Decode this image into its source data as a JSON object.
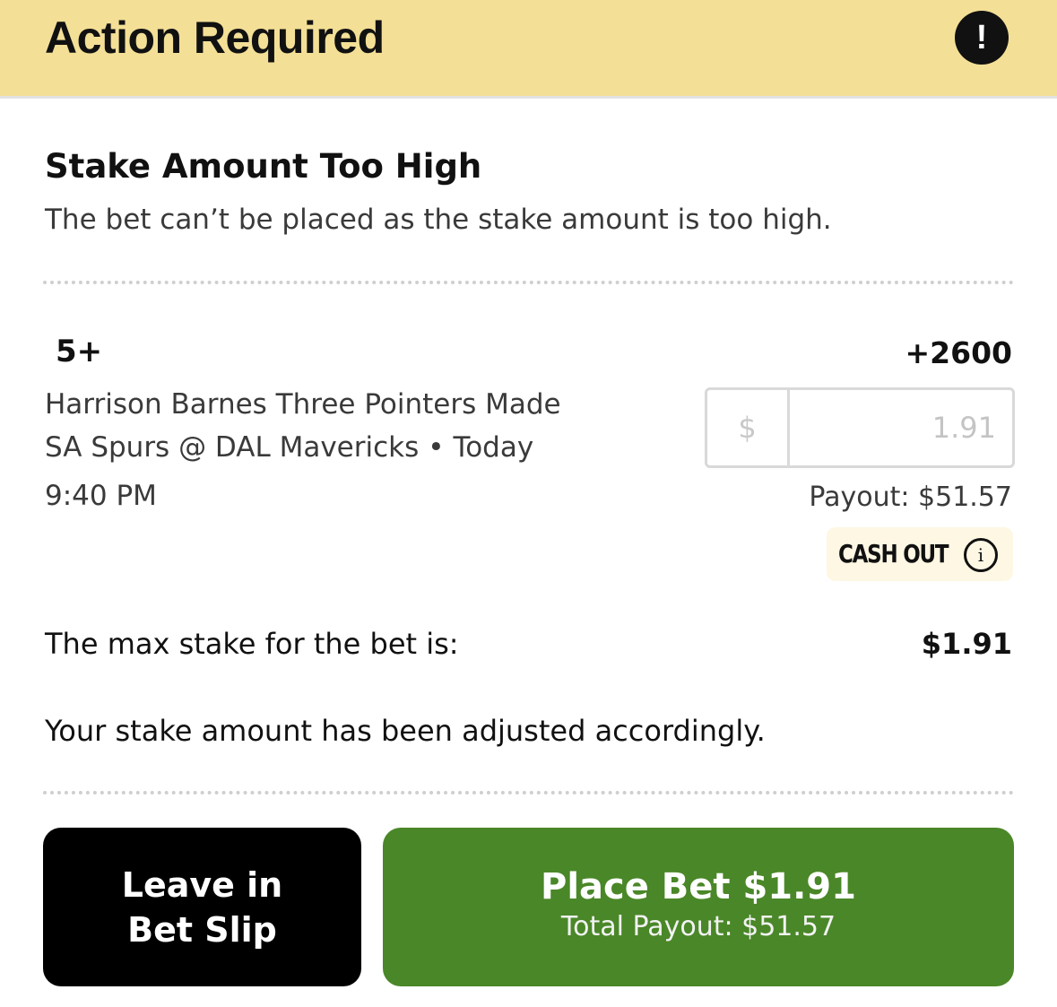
{
  "header": {
    "title": "Action Required",
    "alert_icon": "!",
    "background": "#f3df96"
  },
  "error": {
    "title": "Stake Amount Too High",
    "description": "The bet can’t be placed as the stake amount is too high."
  },
  "bet": {
    "selection": "5+",
    "odds": "+2600",
    "market": "Harrison Barnes Three Pointers Made",
    "event": "SA Spurs @ DAL Mavericks",
    "separator": "•",
    "day": "Today",
    "time": "9:40 PM",
    "stake": {
      "currency": "$",
      "placeholder": "1.91"
    },
    "payout": "Payout: $51.57",
    "cashout": {
      "label": "CASH OUT",
      "icon": "info-icon",
      "icon_glyph": "i"
    }
  },
  "max_stake": {
    "label": "The max stake for the bet is:",
    "value": "$1.91"
  },
  "adjusted_note": "Your stake amount has been adjusted accordingly.",
  "buttons": {
    "leave": {
      "line1": "Leave in",
      "line2": "Bet Slip",
      "color": "#000000"
    },
    "place": {
      "label": "Place Bet $1.91",
      "sublabel": "Total Payout: $51.57",
      "color": "#4a8728"
    }
  }
}
